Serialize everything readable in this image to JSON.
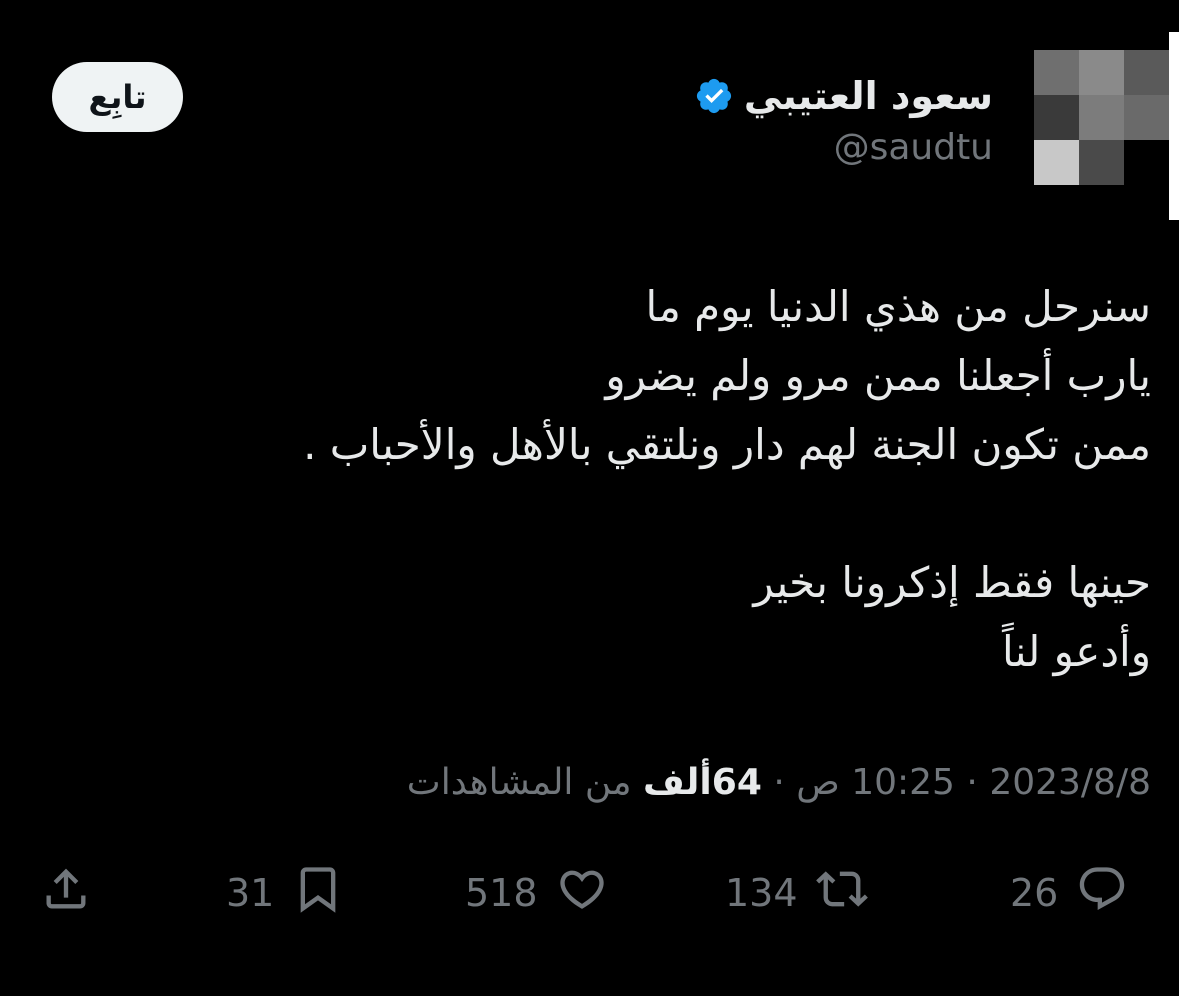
{
  "author": {
    "display_name": "سعود العتيبي",
    "handle": "@saudtu",
    "verified": true
  },
  "follow_button": {
    "label": "تابِع"
  },
  "tweet": {
    "lines": [
      "سنرحل من هذي الدنيا يوم ما",
      "يارب أجعلنا ممن مرو ولم يضرو",
      "ممن تكون الجنة لهم دار ونلتقي بالأهل والأحباب .",
      "حينها فقط إذكرونا بخير",
      "وأدعو لناً"
    ]
  },
  "meta": {
    "date": "2023/8/8",
    "separator": "·",
    "time": "10:25 ص",
    "views_count": "64ألف",
    "views_label": "من المشاهدات"
  },
  "actions": {
    "replies": "26",
    "reposts": "134",
    "likes": "518",
    "bookmarks": "31"
  },
  "colors": {
    "background": "#000000",
    "text_primary": "#e7e9ea",
    "text_secondary": "#71767b",
    "verified": "#1d9bf0",
    "follow_bg": "#eff3f4"
  },
  "icons": {
    "verified": "verified-badge-icon",
    "reply": "reply-icon",
    "repost": "repost-icon",
    "like": "heart-icon",
    "bookmark": "bookmark-icon",
    "share": "share-icon"
  }
}
